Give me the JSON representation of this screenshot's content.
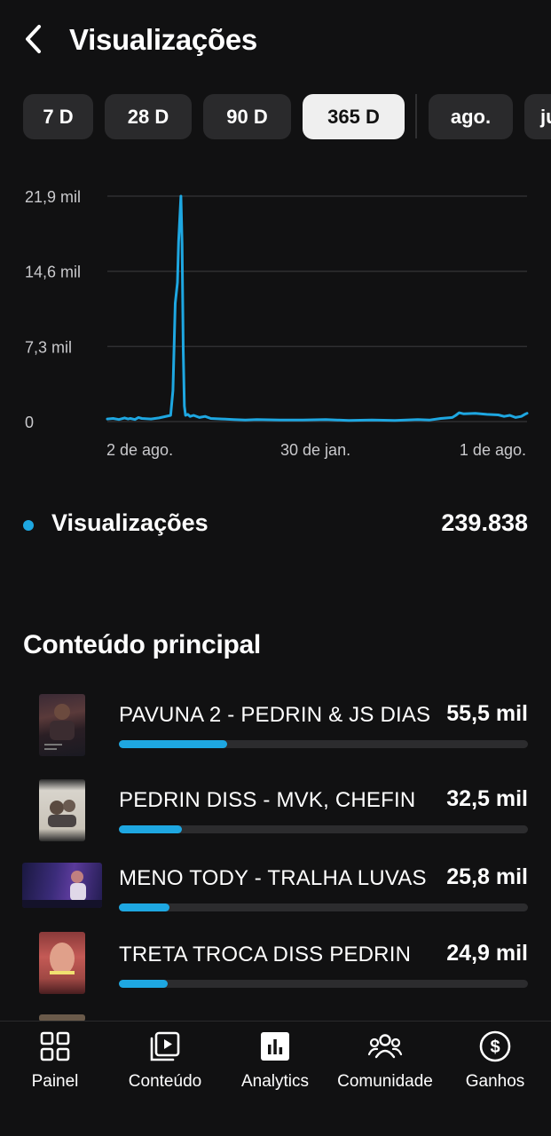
{
  "header": {
    "title": "Visualizações",
    "back_icon": "chevron-left-icon"
  },
  "period_chips": [
    {
      "label": "7 D",
      "active": false
    },
    {
      "label": "28 D",
      "active": false
    },
    {
      "label": "90 D",
      "active": false
    },
    {
      "label": "365 D",
      "active": true
    },
    {
      "label": "ago.",
      "active": false
    },
    {
      "label": "ju",
      "active": false
    }
  ],
  "chart_data": {
    "type": "line",
    "title": "",
    "xlabel": "",
    "ylabel": "",
    "color": "#1ea7e1",
    "y_ticks": [
      "21,9 mil",
      "14,6 mil",
      "7,3 mil",
      "0"
    ],
    "y_tick_values": [
      21900,
      14600,
      7300,
      0
    ],
    "ylim": [
      0,
      21900
    ],
    "x_ticks": [
      "2 de ago.",
      "30 de jan.",
      "1 de ago."
    ],
    "x_tick_days": [
      0,
      181,
      365
    ],
    "xlim": [
      0,
      365
    ],
    "grid": true,
    "series": [
      {
        "days": [
          0,
          5,
          10,
          15,
          18,
          20,
          24,
          27,
          30,
          38,
          45,
          55,
          57,
          59,
          61,
          62,
          64,
          65,
          66,
          67,
          68,
          70,
          72,
          75,
          80,
          85,
          90,
          100,
          110,
          120,
          130,
          150,
          170,
          190,
          210,
          230,
          250,
          270,
          280,
          290,
          300,
          303,
          306,
          310,
          320,
          330,
          340,
          345,
          350,
          355,
          360,
          363,
          365
        ],
        "values": [
          250,
          300,
          200,
          350,
          250,
          300,
          200,
          400,
          300,
          250,
          350,
          600,
          3000,
          11500,
          13500,
          17500,
          21900,
          17300,
          7000,
          1500,
          600,
          700,
          500,
          600,
          400,
          500,
          300,
          250,
          200,
          150,
          200,
          150,
          150,
          200,
          100,
          150,
          100,
          200,
          150,
          300,
          400,
          600,
          850,
          750,
          800,
          700,
          650,
          500,
          600,
          400,
          500,
          700,
          800
        ]
      }
    ]
  },
  "legend": {
    "label": "Visualizações",
    "total": "239.838",
    "dot_color": "#1ea7e1"
  },
  "section_title": "Conteúdo principal",
  "content_items": [
    {
      "title": "PAVUNA 2 - PEDRIN & JS DIAS",
      "value": "55,5 mil",
      "views": 55500,
      "share": 0.265
    },
    {
      "title": "PEDRIN DISS - MVK, CHEFIN",
      "value": "32,5 mil",
      "views": 32500,
      "share": 0.155
    },
    {
      "title": "MENO TODY - TRALHA LUVAS",
      "value": "25,8 mil",
      "views": 25800,
      "share": 0.123
    },
    {
      "title": "TRETA TROCA DISS PEDRIN",
      "value": "24,9 mil",
      "views": 24900,
      "share": 0.119
    }
  ],
  "tabbar": [
    {
      "label": "Painel",
      "icon": "dashboard-grid-icon"
    },
    {
      "label": "Conteúdo",
      "icon": "video-library-icon"
    },
    {
      "label": "Analytics",
      "icon": "bar-chart-icon"
    },
    {
      "label": "Comunidade",
      "icon": "community-people-icon"
    },
    {
      "label": "Ganhos",
      "icon": "dollar-circle-icon"
    }
  ]
}
